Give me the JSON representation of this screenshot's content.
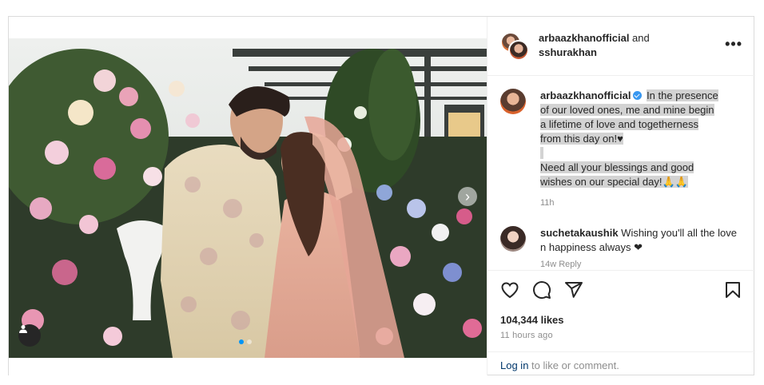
{
  "post": {
    "header": {
      "user1": "arbaazkhanofficial",
      "joiner": " and",
      "user2": "sshurakhan",
      "more_icon": "more-horizontal-icon"
    },
    "caption": {
      "username": "arbaazkhanofficial",
      "verified": true,
      "lines": [
        "In the presence",
        "of our loved ones, me and mine begin",
        "a lifetime of love and togetherness",
        "from this day on!♥",
        "Need all your blessings and good",
        "wishes on our special day!🙏🙏"
      ],
      "time": "11h"
    },
    "comment": {
      "username": "suchetakaushik",
      "text": "Wishing you'll all the love n happiness always ❤",
      "meta": "14w Reply"
    },
    "actions": {
      "like_icon": "heart-icon",
      "comment_icon": "comment-icon",
      "share_icon": "share-icon",
      "save_icon": "bookmark-icon"
    },
    "likes": "104,344 likes",
    "timestamp": "11 hours ago",
    "footer": {
      "login": "Log in",
      "rest": " to like or comment."
    },
    "media": {
      "next_icon": "chevron-right-icon",
      "tag_icon": "user-tag-icon",
      "carousel_count": 2,
      "carousel_active": 1
    }
  },
  "colors": {
    "accent": "#0095f6",
    "verified": "#3897f0",
    "link": "#00376b",
    "muted": "#8e8e8e",
    "border": "#dbdbdb"
  }
}
